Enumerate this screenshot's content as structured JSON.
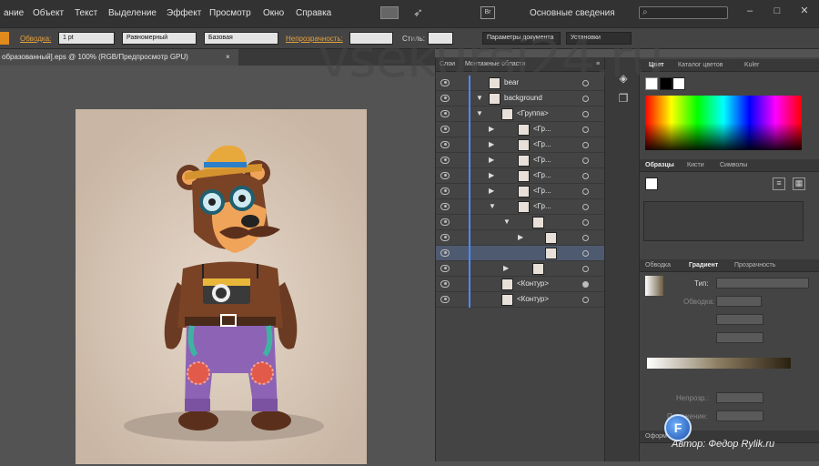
{
  "menubar": {
    "items": [
      "ание",
      "Объект",
      "Текст",
      "Выделение",
      "Эффект",
      "Просмотр",
      "Окно",
      "Справка"
    ],
    "br_icon": "Br",
    "workspace": "Основные сведения",
    "win_buttons": [
      "–",
      "□",
      "✕"
    ]
  },
  "controlbar": {
    "stroke_label": "Обводка:",
    "stroke_value": "1 pt",
    "profile_value": "Равномерный",
    "brush_value": "Базовая",
    "opacity_label": "Непрозрачность:",
    "style_label": "Стиль:",
    "doc_settings": "Параметры документа",
    "prefs": "Установки"
  },
  "document": {
    "tab_title": "образованный].eps @ 100% (RGB/Предпросмотр GPU)",
    "tab_close": "×"
  },
  "layers_panel": {
    "tabs": [
      "Слои",
      "Монтажные области"
    ],
    "rows": [
      {
        "name": "bear",
        "level": 0,
        "arrow": "",
        "circle": "empty"
      },
      {
        "name": "background",
        "level": 0,
        "arrow": "▼",
        "circle": "empty"
      },
      {
        "name": "<Группа>",
        "level": 1,
        "arrow": "▼",
        "circle": "empty"
      },
      {
        "name": "<Гр...",
        "level": 2,
        "arrow": "▶",
        "circle": "empty"
      },
      {
        "name": "<Гр...",
        "level": 2,
        "arrow": "▶",
        "circle": "empty"
      },
      {
        "name": "<Гр...",
        "level": 2,
        "arrow": "▶",
        "circle": "empty"
      },
      {
        "name": "<Гр...",
        "level": 2,
        "arrow": "▶",
        "circle": "empty"
      },
      {
        "name": "<Гр...",
        "level": 2,
        "arrow": "▶",
        "circle": "empty"
      },
      {
        "name": "<Гр...",
        "level": 2,
        "arrow": "▼",
        "circle": "empty"
      },
      {
        "name": "",
        "level": 3,
        "arrow": "▼",
        "circle": "empty"
      },
      {
        "name": "",
        "level": 4,
        "arrow": "▶",
        "circle": "empty"
      },
      {
        "name": "",
        "level": 4,
        "arrow": "",
        "circle": "empty",
        "selected": true
      },
      {
        "name": "",
        "level": 3,
        "arrow": "▶",
        "circle": "empty"
      },
      {
        "name": "<Контур>",
        "level": 1,
        "arrow": "",
        "circle": "fill"
      },
      {
        "name": "<Контур>",
        "level": 1,
        "arrow": "",
        "circle": "empty"
      }
    ]
  },
  "color_panel": {
    "tabs": [
      "Цвет",
      "Каталог цветов",
      "Kuler"
    ]
  },
  "swatches_panel": {
    "tabs": [
      "Образцы",
      "Кисти",
      "Символы"
    ]
  },
  "gradient_panel": {
    "tabs": [
      "Обводка",
      "Градиент",
      "Прозрачность"
    ],
    "type_label": "Тип:",
    "stroke_label": "Обводка:",
    "opacity_label": "Непрозр.:",
    "location_label": "Положение:"
  },
  "bottom_panel": {
    "tab": "Оформ"
  },
  "watermark": "vsekursi24.ru",
  "author": "Автор: Федор",
  "author_site": "Rylik.ru",
  "author_logo": "F"
}
